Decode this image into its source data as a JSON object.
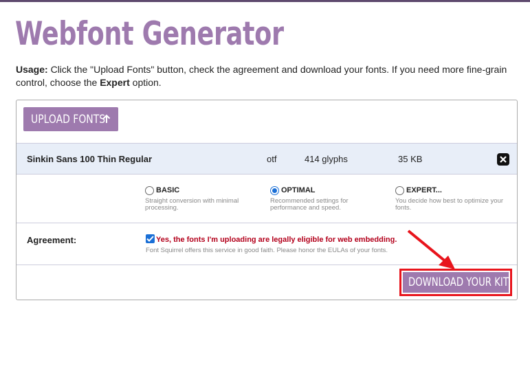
{
  "header": {
    "title": "Webfont Generator",
    "usage_label": "Usage:",
    "usage_text_1": " Click the \"Upload Fonts\" button, check the agreement and download your fonts. If you need more fine-grain control, choose the ",
    "usage_bold": "Expert",
    "usage_text_2": " option."
  },
  "upload": {
    "label": "UPLOAD FONTS",
    "icon": "arrow-up-icon"
  },
  "font": {
    "name": "Sinkin Sans 100 Thin Regular",
    "format": "otf",
    "glyphs": "414 glyphs",
    "size": "35 KB",
    "remove_icon": "close-icon"
  },
  "options": [
    {
      "label": "BASIC",
      "desc": "Straight conversion with minimal processing.",
      "selected": false
    },
    {
      "label": "OPTIMAL",
      "desc": "Recommended settings for performance and speed.",
      "selected": true
    },
    {
      "label": "EXPERT...",
      "desc": "You decide how best to optimize your fonts.",
      "selected": false
    }
  ],
  "agreement": {
    "label": "Agreement:",
    "checked": true,
    "text": "Yes, the fonts I'm uploading are legally eligible for web embedding.",
    "note": "Font Squirrel offers this service in good faith. Please honor the EULAs of your fonts."
  },
  "download": {
    "label": "DOWNLOAD YOUR KIT"
  },
  "colors": {
    "accent": "#9e7aae",
    "highlight_border": "#e8141c",
    "agreement_text": "#b3001b",
    "font_row_bg": "#e8eef8"
  }
}
